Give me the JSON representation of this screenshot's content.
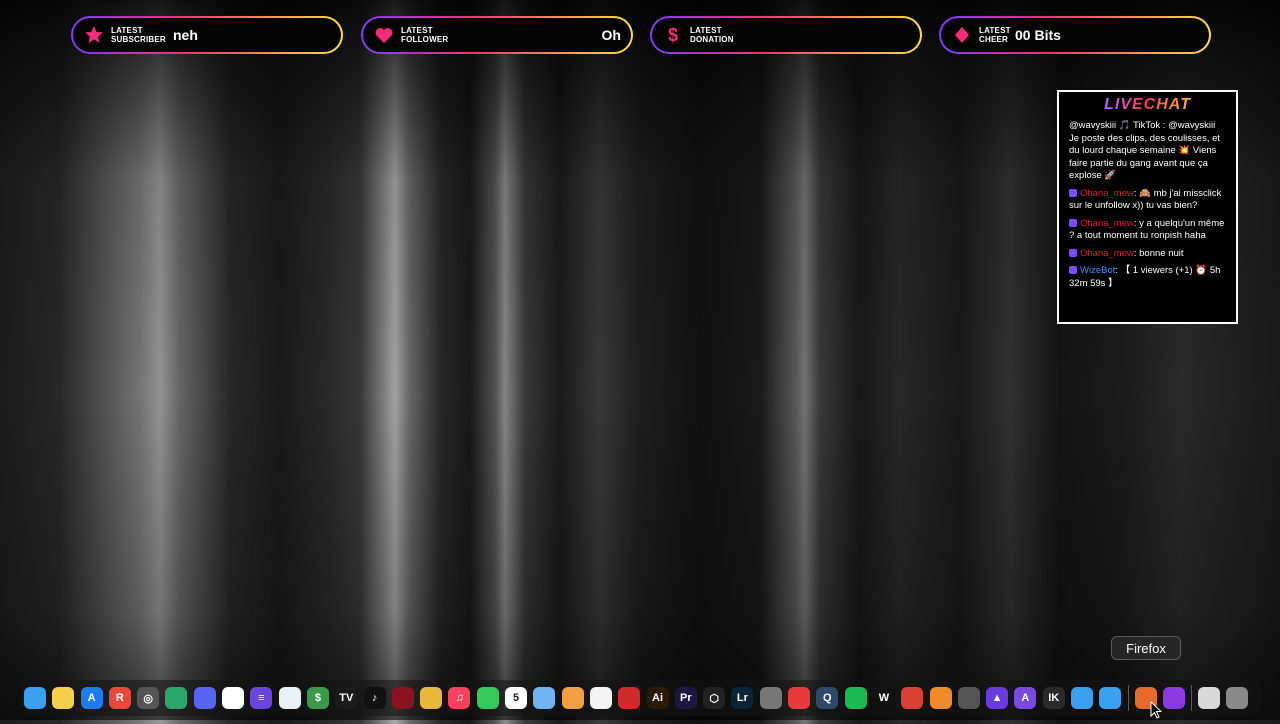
{
  "alerts": [
    {
      "label_line1": "Latest",
      "label_line2": "Subscriber",
      "value": "neh",
      "icon": "star-icon",
      "icon_color": "#ff2b7a"
    },
    {
      "label_line1": "Latest",
      "label_line2": "Follower",
      "value": "Oh",
      "icon": "heart-icon",
      "icon_color": "#ff2b7a"
    },
    {
      "label_line1": "Latest",
      "label_line2": "Donation",
      "value": "",
      "icon": "dollar-icon",
      "icon_color": "#ff2b7a"
    },
    {
      "label_line1": "Latest",
      "label_line2": "Cheer",
      "value": "00 Bits",
      "icon": "diamond-icon",
      "icon_color": "#ff2b7a"
    }
  ],
  "chat": {
    "title": "LIVECHAT",
    "messages": [
      {
        "user": "",
        "text": "@wavyskiii 🎵 TikTok : @wavyskiii Je poste des clips, des coulisses, et du lourd chaque semaine 💥 Viens faire partie du gang avant que ça explose 🚀"
      },
      {
        "user": "Ohana_mew",
        "text": ": 🙈 mb j'ai missclick sur le unfollow x)) tu vas bien?"
      },
      {
        "user": "Ohana_mew",
        "text": ": y a quelqu'un même ? a tout moment tu ronpish haha"
      },
      {
        "user": "Ohana_mew",
        "text": ": bonne nuit"
      },
      {
        "user": "WizeBot",
        "text": ": 【 1 viewers (+1) ⏰ 5h 32m 59s 】"
      }
    ]
  },
  "tooltip": "Firefox",
  "dock": [
    {
      "name": "finder-icon",
      "color": "#3aa0f0",
      "glyph": ""
    },
    {
      "name": "notes-icon",
      "color": "#f2d04a",
      "glyph": ""
    },
    {
      "name": "app-store-icon",
      "color": "#1e7cf2",
      "glyph": "A"
    },
    {
      "name": "rewind-icon",
      "color": "#e8483c",
      "glyph": "R"
    },
    {
      "name": "activity-monitor-icon",
      "color": "#555",
      "glyph": "◎"
    },
    {
      "name": "android-icon",
      "color": "#2aa66a",
      "glyph": ""
    },
    {
      "name": "discord-icon",
      "color": "#5865f2",
      "glyph": ""
    },
    {
      "name": "capcut-icon",
      "color": "#ffffff",
      "glyph": ""
    },
    {
      "name": "app-purple-icon",
      "color": "#6b45e0",
      "glyph": "≡"
    },
    {
      "name": "freeform-icon",
      "color": "#e9f0f7",
      "glyph": ""
    },
    {
      "name": "stocks-icon",
      "color": "#3a9a4a",
      "glyph": "$"
    },
    {
      "name": "tradingview-icon",
      "color": "#1b1b1b",
      "glyph": "TV"
    },
    {
      "name": "tiktok-icon",
      "color": "#111",
      "glyph": "♪"
    },
    {
      "name": "app-red-icon",
      "color": "#8b1220",
      "glyph": ""
    },
    {
      "name": "chrome-icon",
      "color": "#e8b83a",
      "glyph": ""
    },
    {
      "name": "music-icon",
      "color": "#f8415e",
      "glyph": "♫"
    },
    {
      "name": "messages-icon",
      "color": "#36c85a",
      "glyph": ""
    },
    {
      "name": "calendar-icon",
      "color": "#ffffff",
      "glyph": "5"
    },
    {
      "name": "maps-icon",
      "color": "#6fb3f2",
      "glyph": ""
    },
    {
      "name": "photos-icon",
      "color": "#f0a040",
      "glyph": ""
    },
    {
      "name": "reminders-icon",
      "color": "#f4f4f4",
      "glyph": ""
    },
    {
      "name": "app-presenter-icon",
      "color": "#d22a2a",
      "glyph": ""
    },
    {
      "name": "illustrator-icon",
      "color": "#2b1a05",
      "glyph": "Ai"
    },
    {
      "name": "premiere-icon",
      "color": "#1f1640",
      "glyph": "Pr"
    },
    {
      "name": "unity-icon",
      "color": "#222",
      "glyph": "⬡"
    },
    {
      "name": "lightroom-icon",
      "color": "#0b2538",
      "glyph": "Lr"
    },
    {
      "name": "system-settings-icon",
      "color": "#777",
      "glyph": ""
    },
    {
      "name": "timer-icon",
      "color": "#e83a3a",
      "glyph": ""
    },
    {
      "name": "quicktime-icon",
      "color": "#2e4a6a",
      "glyph": "Q"
    },
    {
      "name": "spotify-icon",
      "color": "#1db954",
      "glyph": ""
    },
    {
      "name": "waves-icon",
      "color": "#111",
      "glyph": "W"
    },
    {
      "name": "todoist-icon",
      "color": "#db4035",
      "glyph": ""
    },
    {
      "name": "fl-studio-icon",
      "color": "#f08a2a",
      "glyph": ""
    },
    {
      "name": "app-gear-icon",
      "color": "#555",
      "glyph": ""
    },
    {
      "name": "app-violet-icon",
      "color": "#6a3ae0",
      "glyph": "▲"
    },
    {
      "name": "arturia-icon",
      "color": "#7a4ae0",
      "glyph": "A"
    },
    {
      "name": "app-ik-icon",
      "color": "#2a2a2a",
      "glyph": "IK"
    },
    {
      "name": "app-blue-fan-icon",
      "color": "#3aa0f0",
      "glyph": ""
    },
    {
      "name": "app-blue-fan2-icon",
      "color": "#3aa0f0",
      "glyph": ""
    },
    {
      "name": "separator",
      "color": "",
      "glyph": ""
    },
    {
      "name": "firefox-icon",
      "color": "#e86a2a",
      "glyph": ""
    },
    {
      "name": "firefox-nightly-icon",
      "color": "#8a3ae0",
      "glyph": ""
    },
    {
      "name": "separator",
      "color": "",
      "glyph": ""
    },
    {
      "name": "downloads-icon",
      "color": "#d9d9d9",
      "glyph": ""
    },
    {
      "name": "trash-icon",
      "color": "#8a8a8a",
      "glyph": ""
    }
  ]
}
